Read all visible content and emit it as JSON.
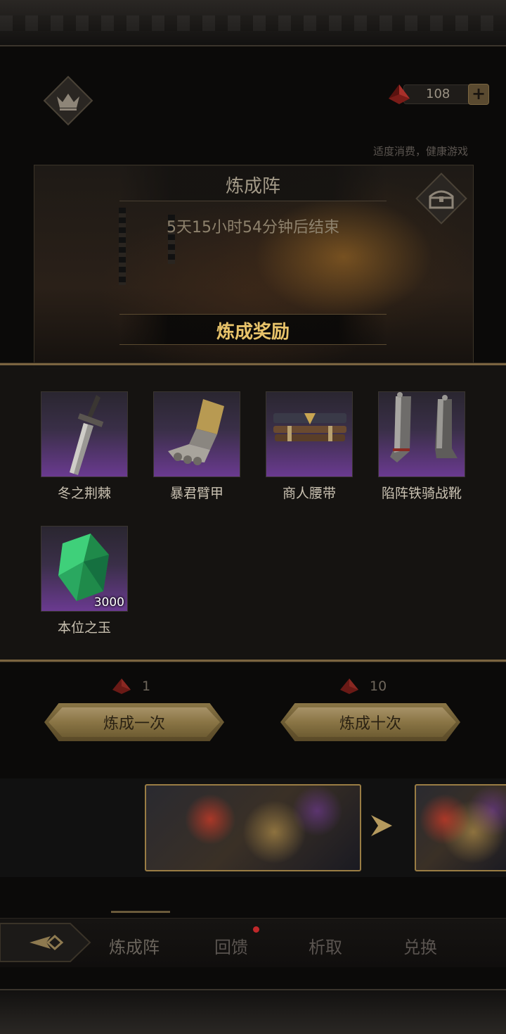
{
  "header": {
    "currency_amount": "108",
    "add_label": "+",
    "notice": "适度消费，健康游戏"
  },
  "panel": {
    "title": "炼成阵",
    "countdown": "5天15小时54分钟后结束",
    "reward_title": "炼成奖励"
  },
  "rewards": [
    {
      "name": "冬之荆棘",
      "icon": "greatsword-icon",
      "qty": ""
    },
    {
      "name": "暴君臂甲",
      "icon": "gauntlet-icon",
      "qty": ""
    },
    {
      "name": "商人腰带",
      "icon": "belt-icon",
      "qty": ""
    },
    {
      "name": "陷阵铁骑战靴",
      "icon": "boots-icon",
      "qty": ""
    },
    {
      "name": "本位之玉",
      "icon": "green-crystal-icon",
      "qty": "3000"
    }
  ],
  "actions": {
    "single": {
      "cost": "1",
      "label": "炼成一次"
    },
    "ten": {
      "cost": "10",
      "label": "炼成十次"
    }
  },
  "tabs": [
    {
      "label": "炼成阵",
      "active": true
    },
    {
      "label": "回馈",
      "badge": true
    },
    {
      "label": "析取"
    },
    {
      "label": "兑换"
    }
  ],
  "colors": {
    "gold_text": "#e8c36a",
    "rarity_purple": "#6a3a90",
    "badge_red": "#c0282a",
    "button_gold": "#a79268"
  }
}
